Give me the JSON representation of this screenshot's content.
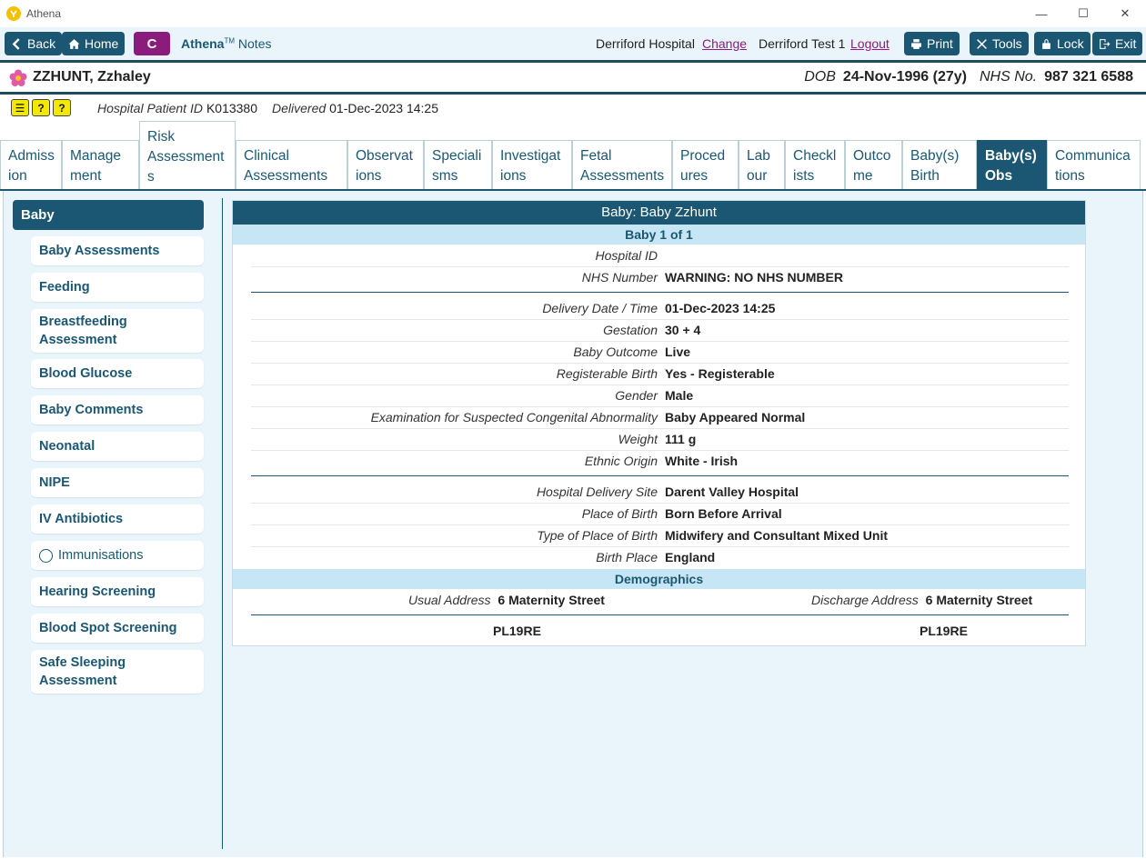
{
  "window": {
    "title": "Athena",
    "min": "—",
    "max": "☐",
    "close": "✕"
  },
  "toolbar": {
    "back": "Back",
    "home": "Home",
    "c": "C",
    "brand": "Athena",
    "tm": "TM",
    "notes": " Notes",
    "hospital": "Derriford Hospital",
    "change": "Change",
    "user": "Derriford Test 1",
    "logout": "Logout",
    "print": "Print",
    "tools": "Tools",
    "lock": "Lock",
    "exit": "Exit"
  },
  "patient": {
    "name": "ZZHUNT, Zzhaley",
    "dob_label": "DOB",
    "dob": "24-Nov-1996 (27y)",
    "nhs_label": "NHS No.",
    "nhs": "987 321 6588",
    "hospital_id_label": "Hospital Patient ID",
    "hospital_id": "K013380",
    "delivered_label": "Delivered",
    "delivered": "01-Dec-2023 14:25"
  },
  "tabs": [
    {
      "l1": "Admiss",
      "l2": "ion"
    },
    {
      "l1": "Manage",
      "l2": "ment"
    },
    {
      "l1": "Risk",
      "l2": "Assessment",
      "l3": "s"
    },
    {
      "l1": "Clinical",
      "l2": "Assessments"
    },
    {
      "l1": "Observat",
      "l2": "ions"
    },
    {
      "l1": "Speciali",
      "l2": "sms"
    },
    {
      "l1": "Investigat",
      "l2": "ions"
    },
    {
      "l1": "Fetal",
      "l2": "Assessments"
    },
    {
      "l1": "Proced",
      "l2": "ures"
    },
    {
      "l1": "Lab",
      "l2": "our"
    },
    {
      "l1": "Checkl",
      "l2": "ists"
    },
    {
      "l1": "Outco",
      "l2": "me"
    },
    {
      "l1": "Baby(s)",
      "l2": "Birth"
    },
    {
      "l1": "Baby(s)",
      "l2": "Obs"
    },
    {
      "l1": "Communica",
      "l2": "tions"
    }
  ],
  "sidebar": {
    "header": "Baby",
    "items": [
      {
        "l1": "Baby Assessments"
      },
      {
        "l1": "Feeding"
      },
      {
        "l1": "Breastfeeding",
        "l2": "Assessment"
      },
      {
        "l1": "Blood Glucose"
      },
      {
        "l1": "Baby Comments"
      },
      {
        "l1": "Neonatal"
      },
      {
        "l1": "NIPE"
      },
      {
        "l1": "IV Antibiotics"
      },
      {
        "l1": "Immunisations"
      },
      {
        "l1": "Hearing Screening"
      },
      {
        "l1": "Blood Spot Screening"
      },
      {
        "l1": "Safe Sleeping",
        "l2": "Assessment"
      }
    ]
  },
  "card": {
    "title": "Baby: Baby Zzhunt",
    "subtitle": "Baby 1 of  1",
    "rows": [
      {
        "label": "Hospital ID",
        "value": ""
      },
      {
        "label": "NHS Number",
        "value": "WARNING: NO NHS NUMBER"
      },
      {
        "label": "Delivery Date / Time",
        "value": "01-Dec-2023 14:25"
      },
      {
        "label": "Gestation",
        "value": "30 + 4"
      },
      {
        "label": "Baby Outcome",
        "value": "Live"
      },
      {
        "label": "Registerable Birth",
        "value": "Yes - Registerable"
      },
      {
        "label": "Gender",
        "value": "Male"
      },
      {
        "label": "Examination for Suspected Congenital Abnormality",
        "value": "Baby Appeared Normal"
      },
      {
        "label": "Weight",
        "value": "111 g"
      },
      {
        "label": "Ethnic Origin",
        "value": "White - Irish"
      },
      {
        "label": "Hospital Delivery Site",
        "value": "Darent Valley Hospital"
      },
      {
        "label": "Place of Birth",
        "value": "Born Before Arrival"
      },
      {
        "label": "Type of Place of Birth",
        "value": "Midwifery and Consultant Mixed Unit"
      },
      {
        "label": "Birth Place",
        "value": "England"
      }
    ],
    "demographics": {
      "title": "Demographics",
      "usual_label": "Usual Address",
      "usual_value": "6 Maternity Street",
      "usual_postcode": "PL19RE",
      "discharge_label": "Discharge Address",
      "discharge_value": "6 Maternity Street",
      "discharge_postcode": "PL19RE"
    }
  }
}
